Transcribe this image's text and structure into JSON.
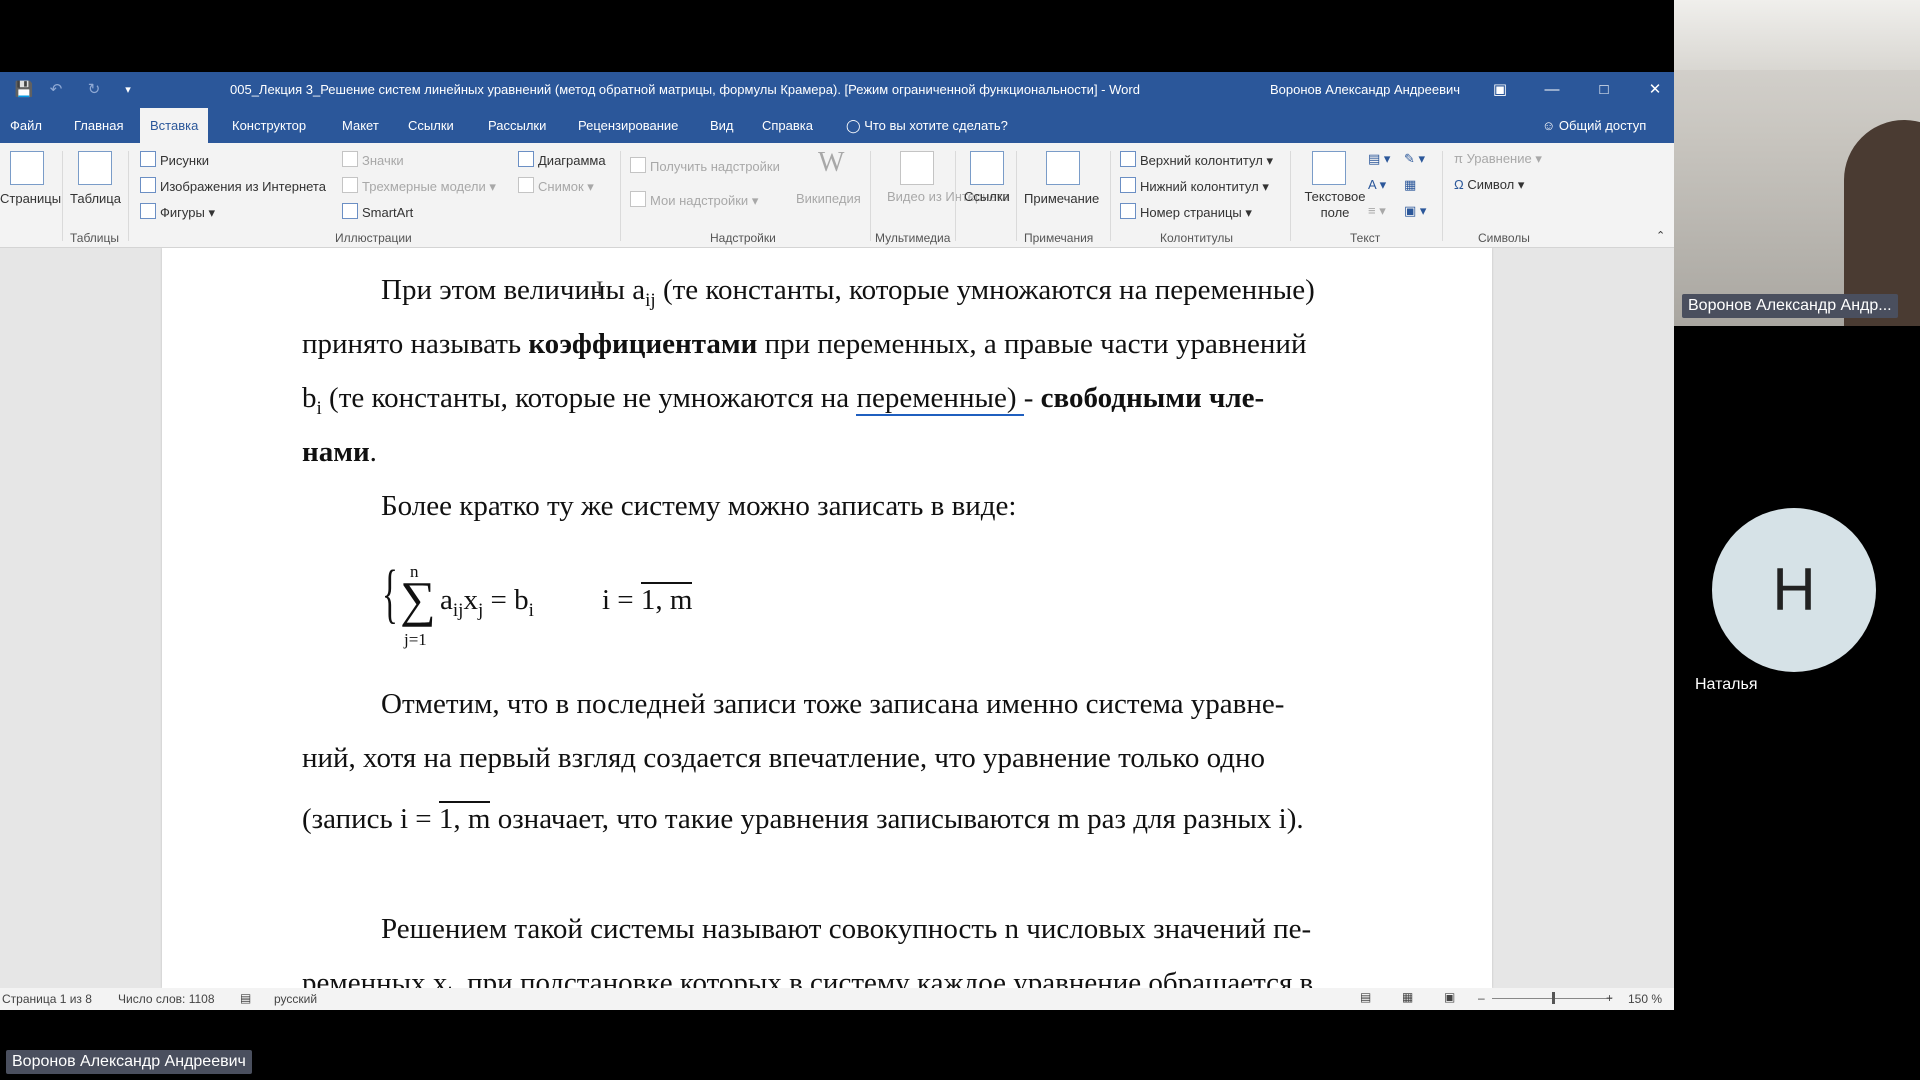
{
  "window": {
    "title": "005_Лекция 3_Решение систем линейных уравнений (метод обратной матрицы, формулы Крамера). [Режим ограниченной функциональности]  -  Word",
    "user": "Воронов Александр Андреевич"
  },
  "tabs": [
    "Файл",
    "Главная",
    "Вставка",
    "Конструктор",
    "Макет",
    "Ссылки",
    "Рассылки",
    "Рецензирование",
    "Вид",
    "Справка"
  ],
  "active_tab": "Вставка",
  "tell_me": "Что вы хотите сделать?",
  "share": "Общий доступ",
  "ribbon": {
    "pages": "Страницы",
    "table": "Таблица",
    "tables_group": "Таблицы",
    "pictures": "Рисунки",
    "online_pictures": "Изображения из Интернета",
    "shapes": "Фигуры",
    "icons": "Значки",
    "models_3d": "Трехмерные модели",
    "smartart": "SmartArt",
    "chart": "Диаграмма",
    "screenshot": "Снимок",
    "illustrations_group": "Иллюстрации",
    "get_addins": "Получить надстройки",
    "my_addins": "Мои надстройки",
    "wikipedia": "Википедия",
    "addins_group": "Надстройки",
    "online_video": "Видео из Интернета",
    "media_group": "Мультимедиа",
    "links": "Ссылки",
    "comment": "Примечание",
    "comments_group": "Примечания",
    "header": "Верхний колонтитул",
    "footer": "Нижний колонтитул",
    "page_number": "Номер страницы",
    "hf_group": "Колонтитулы",
    "text_box": "Текстовое поле",
    "text_group": "Текст",
    "equation": "Уравнение",
    "symbol": "Символ",
    "symbols_group": "Символы"
  },
  "document": {
    "p1_a": "При этом величины a",
    "p1_sub": "ij",
    "p1_b": " (те константы, которые умножаются на переменные)",
    "p2_a": "принято называть ",
    "p2_bold": "коэффициентами",
    "p2_b": " при переменных, а правые части уравнений",
    "p3_a": "b",
    "p3_sub": "i",
    "p3_b": " (те константы, которые не умножаются на ",
    "p3_link": "переменные)  ",
    "p3_c": " - ",
    "p3_bold": "свободными чле-",
    "p4_bold": "нами",
    "p4_dot": ".",
    "p5": "Более кратко ту же систему можно записать в виде:",
    "formula_main": "a",
    "formula_ij": "ij",
    "formula_x": "x",
    "formula_j": "j",
    "formula_eq": " = b",
    "formula_i": "i",
    "formula_range_left": "i = ",
    "formula_range": "1, m",
    "sum_top": "n",
    "sum_bottom": "j=1",
    "p6": "Отметим, что в последней записи тоже записана именно система уравне-",
    "p7": "ний, хотя на первый взгляд создается впечатление, что уравнение только одно",
    "p8_a": "(запись  i = ",
    "p8_range": "1, m",
    "p8_b": " означает, что такие уравнения записываются m раз для разных i).",
    "p9": "Решением такой системы называют совокупность n числовых значений пе-",
    "p10_a": "ременных x",
    "p10_sub": "j",
    "p10_b": ", при подстановке которых в систему каждое уравнение обращается в"
  },
  "status": {
    "page": "Страница 1 из 8",
    "words": "Число слов: 1108",
    "language": "русский",
    "zoom": "150 %"
  },
  "participants": {
    "video_label": "Воронов Александр Андр...",
    "avatar_letter": "Н",
    "avatar_name": "Наталья",
    "bottom_label": "Воронов Александр Андреевич"
  }
}
